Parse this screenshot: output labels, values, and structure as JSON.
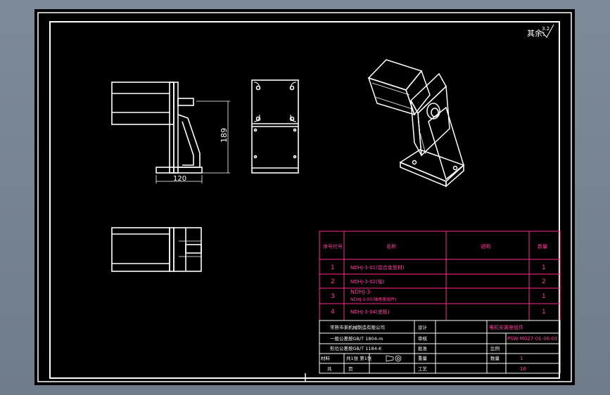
{
  "surface_finish": {
    "label": "其余:",
    "roughness": "3.2"
  },
  "dims": {
    "height": "189",
    "width": "120"
  },
  "parts_table": {
    "headers": [
      "序号代号",
      "名称",
      "说明",
      "数量"
    ],
    "rows": [
      {
        "no": "1",
        "name": "NDHJ-3-01(铝合金型材)",
        "qty": "1"
      },
      {
        "no": "2",
        "name": "NDHJ-3-02(轴)",
        "qty": "2"
      },
      {
        "no": "3",
        "name": "NDHJ-3-03(轴承座组件)",
        "qty": "1"
      },
      {
        "no": "4",
        "name": "NDHJ-3-04(底板)",
        "qty": "1"
      }
    ],
    "row3_line1": "NDHJ-3-"
  },
  "title_block": {
    "company": "常熟市某机械制造有限公司",
    "std1": "一般公差按GB/T 1804-m",
    "std2": "形位公差按GB/T 1184-K",
    "design_label": "设计",
    "check_label": "审核",
    "process_label": "工艺",
    "approve_label": "批准",
    "scale_label": "比例",
    "quantity_label": "数量",
    "weight_label": "重量",
    "sheet_info": "共1张 第1张",
    "material_label": "材料",
    "drawing_title": "电机安装座组件",
    "drawing_no": "PSW-M027-01-06-00",
    "scale_value": "1",
    "quantity_value": "1",
    "weight_value": "16",
    "share": "共",
    "page": "页"
  },
  "colors": {
    "lines": "#ffffff",
    "table": "#ff2d8a",
    "text_pink": "#ff3fa0",
    "background": "#7d8a99",
    "sheet": "#000000"
  }
}
